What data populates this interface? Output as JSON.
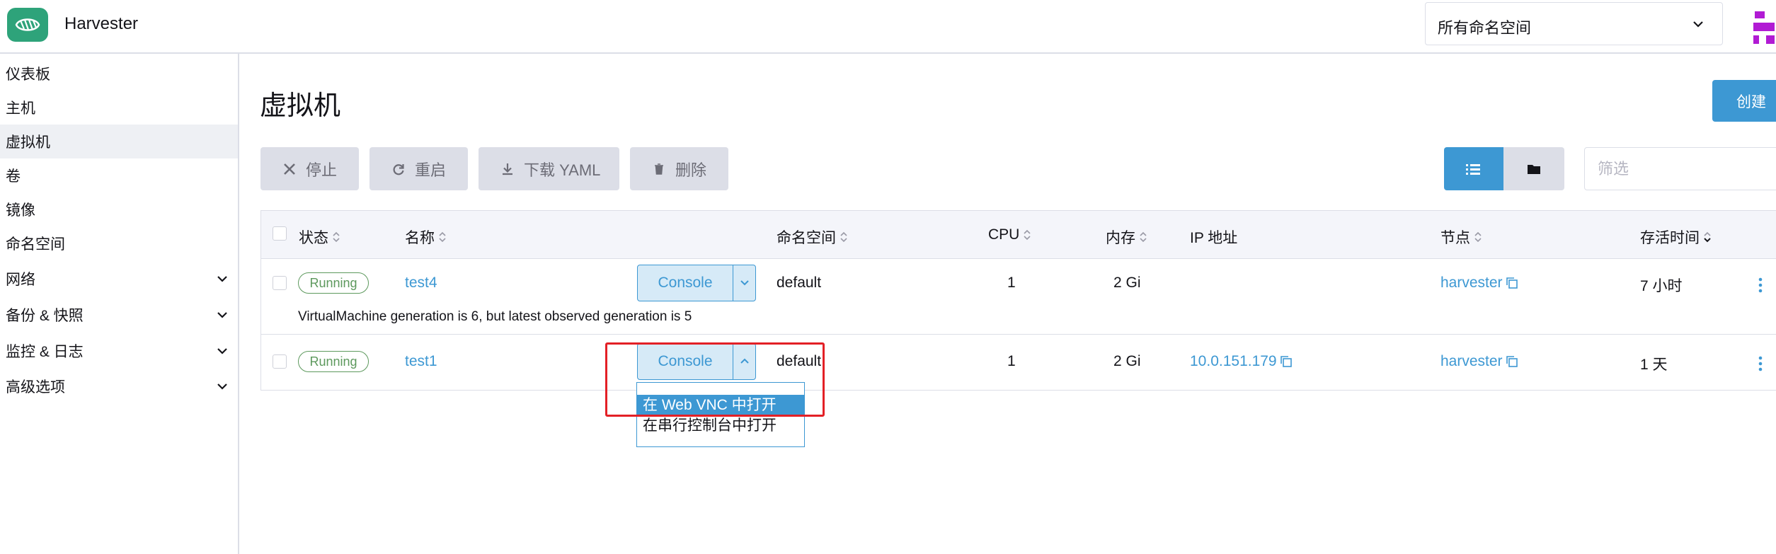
{
  "header": {
    "app_title": "Harvester",
    "namespace_select": "所有命名空间"
  },
  "sidebar": {
    "items": [
      {
        "label": "仪表板"
      },
      {
        "label": "主机"
      },
      {
        "label": "虚拟机"
      },
      {
        "label": "卷"
      },
      {
        "label": "镜像"
      },
      {
        "label": "命名空间"
      },
      {
        "label": "网络"
      },
      {
        "label": "备份 & 快照"
      },
      {
        "label": "监控 & 日志"
      },
      {
        "label": "高级选项"
      }
    ]
  },
  "page": {
    "title": "虚拟机",
    "create_label": "创建"
  },
  "toolbar": {
    "stop": "停止",
    "restart": "重启",
    "download_yaml": "下载 YAML",
    "delete": "删除",
    "filter_placeholder": "筛选"
  },
  "table": {
    "columns": {
      "state": "状态",
      "name": "名称",
      "namespace": "命名空间",
      "cpu": "CPU",
      "memory": "内存",
      "ip": "IP 地址",
      "node": "节点",
      "age": "存活时间"
    },
    "rows": [
      {
        "state": "Running",
        "name": "test4",
        "console": "Console",
        "namespace": "default",
        "cpu": "1",
        "memory": "2 Gi",
        "ip": "",
        "node": "harvester",
        "age": "7 小时",
        "message": "VirtualMachine generation is 6, but latest observed generation is 5"
      },
      {
        "state": "Running",
        "name": "test1",
        "console": "Console",
        "namespace": "default",
        "cpu": "1",
        "memory": "2 Gi",
        "ip": "10.0.151.179",
        "node": "harvester",
        "age": "1 天"
      }
    ]
  },
  "console_menu": {
    "options": [
      "在 Web VNC 中打开",
      "在串行控制台中打开"
    ],
    "selected": "在 Web VNC 中打开"
  },
  "colors": {
    "accent": "#3d98d3",
    "brand": "#2ea37a",
    "running": "#5d995d",
    "highlight": "#e32026"
  }
}
